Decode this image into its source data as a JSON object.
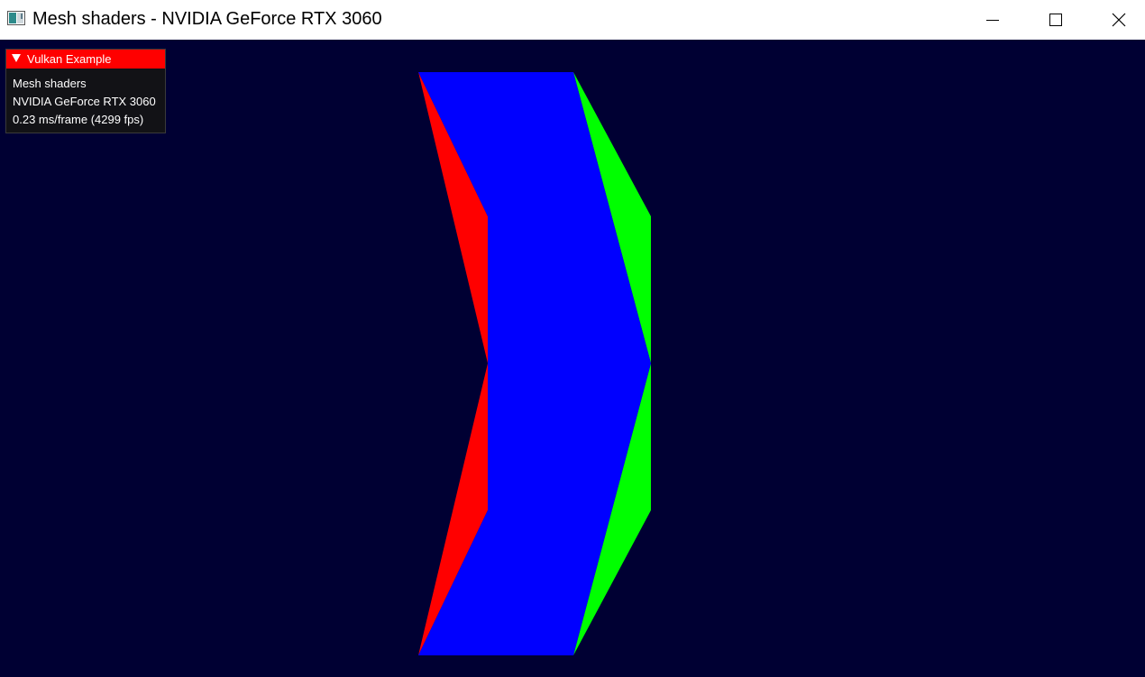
{
  "window": {
    "title": "Mesh shaders - NVIDIA GeForce RTX 3060"
  },
  "title_buttons": {
    "minimize_icon": "minimize-icon",
    "maximize_icon": "maximize-icon",
    "close_icon": "close-icon"
  },
  "overlay": {
    "header": "Vulkan Example",
    "lines": [
      "Mesh shaders",
      "NVIDIA GeForce RTX 3060",
      "0.23 ms/frame (4299 fps)"
    ]
  },
  "colors": {
    "background": "#000033",
    "overlay_header": "#ff0000",
    "triangle_left": "#ff0000",
    "triangle_center": "#0000ff",
    "triangle_right": "#00ff00"
  }
}
